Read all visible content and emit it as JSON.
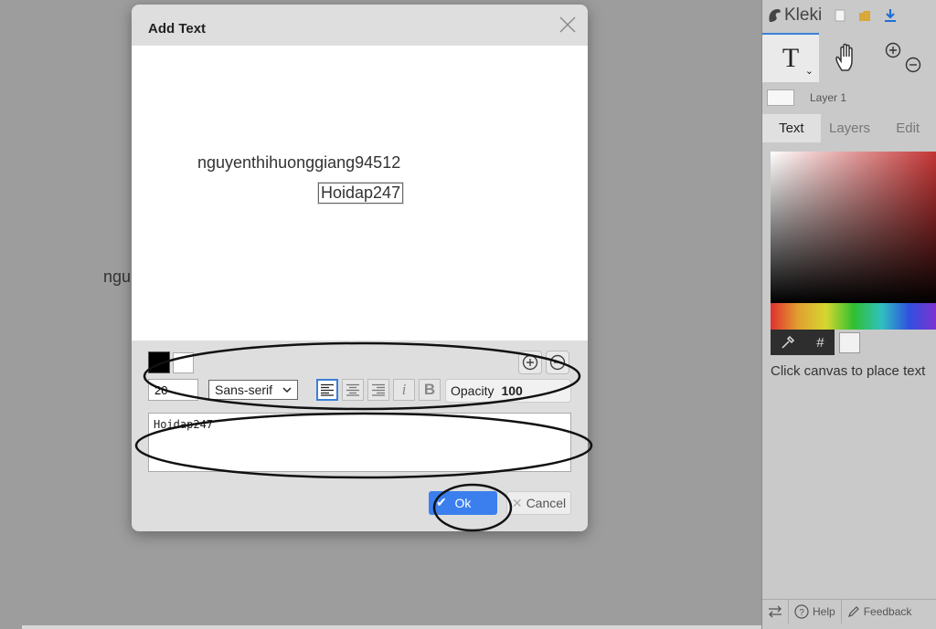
{
  "background": {
    "partial_text": "ngu"
  },
  "sidebar": {
    "app_name": "Kleki",
    "layer_name": "Layer 1",
    "tabs": [
      {
        "label": "Text"
      },
      {
        "label": "Layers"
      },
      {
        "label": "Edit"
      }
    ],
    "hex_label": "#",
    "hint": "Click canvas to place text",
    "bottom": {
      "help_label": "Help",
      "feedback_label": "Feedback"
    }
  },
  "dialog": {
    "title": "Add Text",
    "preview": {
      "line1": "nguyenthihuonggiang94512",
      "line2": "Hoidap247"
    },
    "size_value": "20",
    "font_family": "Sans-serif",
    "italic_label": "i",
    "bold_label": "B",
    "opacity_label": "Opacity",
    "opacity_value": "100",
    "text_value": "Hoidap247",
    "ok_label": "Ok",
    "cancel_label": "Cancel"
  },
  "colors": {
    "accent": "#3b7fee",
    "text_color": "#000000",
    "background_color": "#ffffff"
  },
  "icons": [
    "kleki-logo-icon",
    "new-file-icon",
    "open-folder-icon",
    "download-icon",
    "text-tool-icon",
    "hand-tool-icon",
    "zoom-in-icon",
    "zoom-out-icon",
    "eyedropper-icon",
    "swap-icon",
    "help-icon",
    "feedback-icon",
    "close-icon",
    "align-left-icon",
    "align-center-icon",
    "align-right-icon",
    "checkmark-icon"
  ]
}
